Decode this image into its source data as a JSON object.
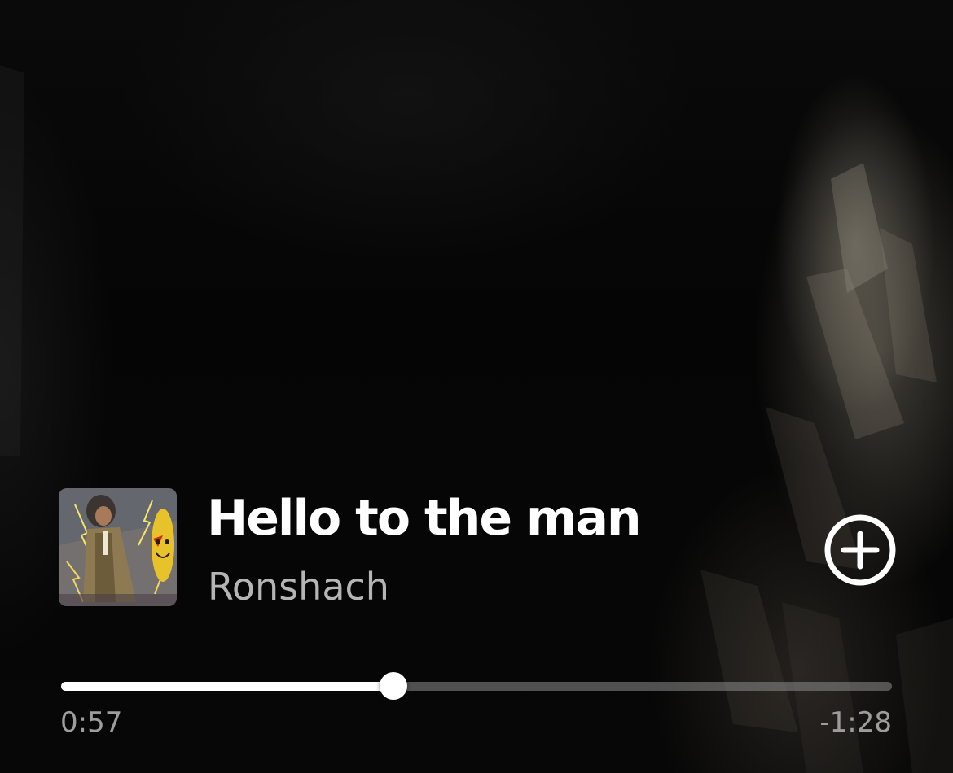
{
  "track": {
    "title": "Hello to the man",
    "artist": "Ronshach",
    "album_art_icon": "album-cover-art"
  },
  "actions": {
    "add_icon": "plus-circle-icon"
  },
  "playback": {
    "elapsed": "0:57",
    "remaining": "-1:28",
    "progress_fraction": 0.4
  },
  "colors": {
    "accent": "#ffffff",
    "secondary_text": "#b5b5b5",
    "time_text": "#9d9d9d",
    "background": "#050505"
  }
}
